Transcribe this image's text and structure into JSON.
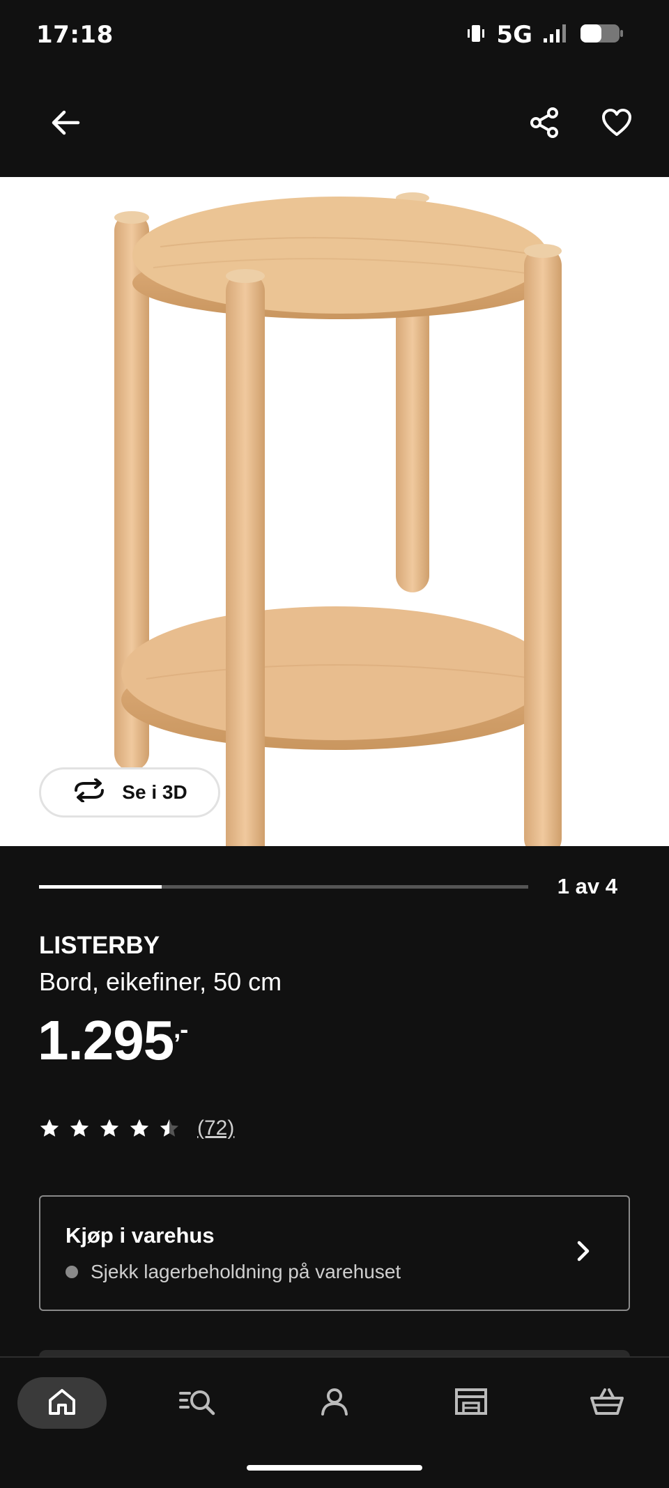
{
  "status_bar": {
    "time": "17:18",
    "network": "5G",
    "icons": [
      "vibrate-icon",
      "signal-icon",
      "battery-icon"
    ]
  },
  "app_bar": {
    "icons": [
      "back-arrow-icon",
      "share-icon",
      "heart-icon"
    ]
  },
  "hero": {
    "view_3d_label": "Se i 3D",
    "view_3d_icon": "rotate-icon"
  },
  "gallery": {
    "position_text": "1 av 4",
    "progress": 0.25
  },
  "product": {
    "name": "LISTERBY",
    "description": "Bord, eikefiner, 50 cm",
    "price": "1.295",
    "price_suffix": ",-",
    "rating": 4.5,
    "review_count": "(72)"
  },
  "store_card": {
    "title": "Kjøp i varehus",
    "subtitle": "Sjekk lagerbeholdning på varehuset",
    "status_color": "#8a8a8a"
  },
  "bottom_nav": {
    "items": [
      {
        "icon": "home-icon",
        "active": true
      },
      {
        "icon": "search-list-icon",
        "active": false
      },
      {
        "icon": "profile-icon",
        "active": false
      },
      {
        "icon": "store-icon",
        "active": false
      },
      {
        "icon": "basket-icon",
        "active": false
      }
    ]
  },
  "colors": {
    "background": "#111111",
    "text": "#ffffff",
    "hero_background": "#ffffff",
    "wood": "#e3b98b"
  }
}
